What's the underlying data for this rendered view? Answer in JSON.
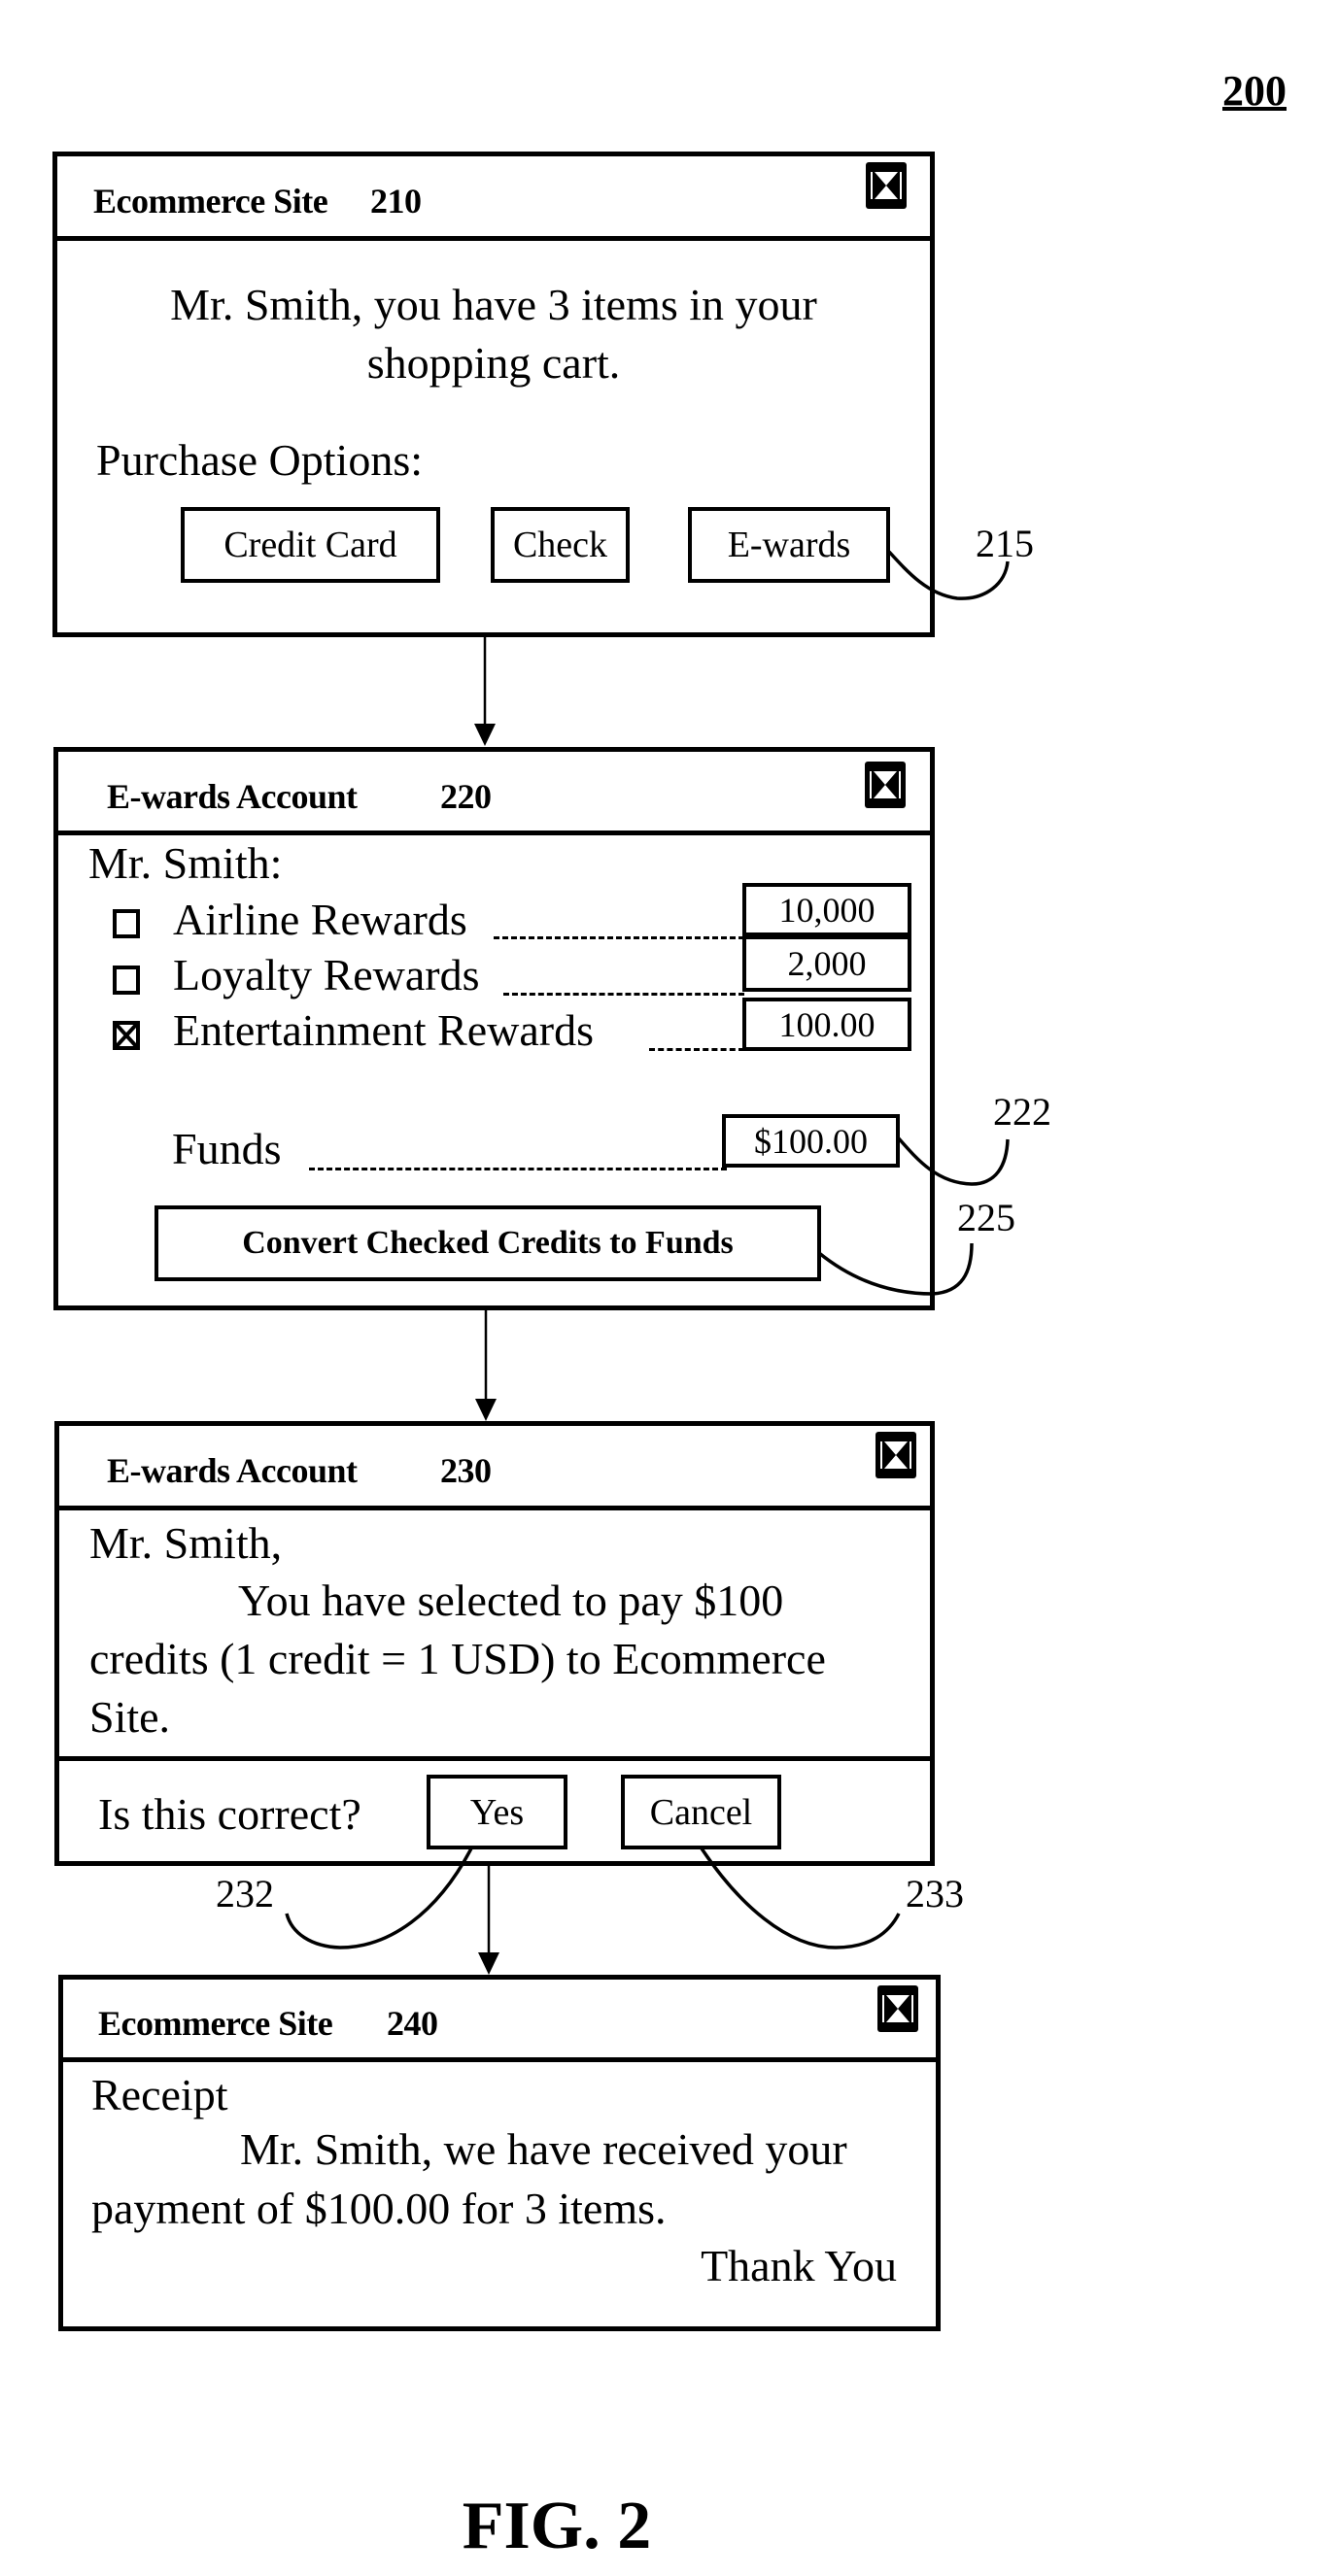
{
  "figure": {
    "number_label": "200",
    "caption": "FIG. 2"
  },
  "window_210": {
    "title": "Ecommerce Site",
    "ref": "210",
    "close_icon": "close-icon",
    "message_line1": "Mr. Smith, you have 3 items in your",
    "message_line2": "shopping cart.",
    "options_label": "Purchase Options:",
    "buttons": [
      {
        "label": "Credit Card"
      },
      {
        "label": "Check"
      },
      {
        "label": "E-wards"
      }
    ],
    "callout_ewards": "215"
  },
  "window_220": {
    "title": "E-wards Account",
    "ref": "220",
    "close_icon": "close-icon",
    "greeting": "Mr. Smith:",
    "rewards": [
      {
        "label": "Airline Rewards",
        "value": "10,000",
        "checked": false
      },
      {
        "label": "Loyalty Rewards",
        "value": "2,000",
        "checked": false
      },
      {
        "label": "Entertainment Rewards",
        "value": "100.00",
        "checked": true
      }
    ],
    "funds_label": "Funds",
    "funds_value": "$100.00",
    "convert_button": "Convert Checked Credits to Funds",
    "callout_funds": "222",
    "callout_convert": "225"
  },
  "window_230": {
    "title": "E-wards Account",
    "ref": "230",
    "close_icon": "close-icon",
    "greeting": "Mr. Smith,",
    "message_line1": "You have selected to pay $100",
    "message_line2": "credits (1 credit = 1 USD) to Ecommerce",
    "message_line3": "Site.",
    "confirm_prompt": "Is this correct?",
    "yes_button": "Yes",
    "cancel_button": "Cancel",
    "callout_yes": "232",
    "callout_cancel": "233"
  },
  "window_240": {
    "title": "Ecommerce Site",
    "ref": "240",
    "close_icon": "close-icon",
    "heading": "Receipt",
    "message_line1": "Mr. Smith, we have received your",
    "message_line2": "payment of $100.00 for 3 items.",
    "closing": "Thank You"
  }
}
